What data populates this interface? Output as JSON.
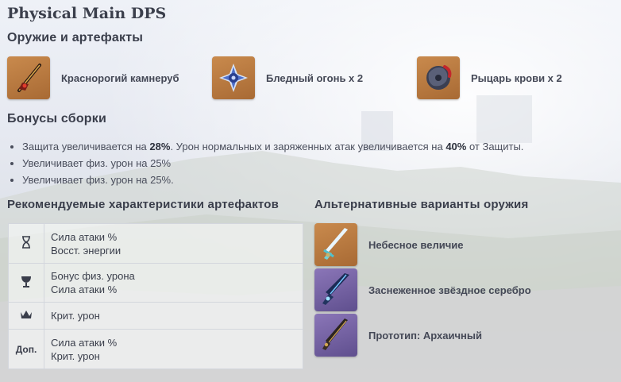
{
  "title": "Physical Main DPS",
  "weapons_section": {
    "heading": "Оружие и артефакты",
    "items": [
      {
        "label": "Краснорогий камнеруб",
        "icon": "axe-weapon-icon"
      },
      {
        "label": "Бледный огонь x 2",
        "icon": "pale-flame-flower-icon"
      },
      {
        "label": "Рыцарь крови x 2",
        "icon": "bloodstained-flower-icon"
      }
    ]
  },
  "set_bonuses": {
    "heading": "Бонусы сборки",
    "items": [
      {
        "pre": "Защита увеличивается на ",
        "b1": "28%",
        "mid": ". Урон нормальных и заряженных атак увеличивается на ",
        "b2": "40%",
        "post": " от Защиты."
      },
      {
        "pre": "Увеличивает физ. урон на 25%",
        "b1": "",
        "mid": "",
        "b2": "",
        "post": ""
      },
      {
        "pre": "Увеличивает физ. урон на 25%.",
        "b1": "",
        "mid": "",
        "b2": "",
        "post": ""
      }
    ]
  },
  "artifact_stats": {
    "heading": "Рекомендуемые характеристики артефактов",
    "rows": [
      {
        "slot_icon": "hourglass-icon",
        "slot_text": "",
        "line1": "Сила атаки %",
        "line2": "Восст. энергии"
      },
      {
        "slot_icon": "goblet-icon",
        "slot_text": "",
        "line1": "Бонус физ. урона",
        "line2": "Сила атаки %"
      },
      {
        "slot_icon": "crown-icon",
        "slot_text": "",
        "line1": "Крит. урон",
        "line2": ""
      },
      {
        "slot_icon": "",
        "slot_text": "Доп.",
        "line1": "Сила атаки %",
        "line2": "Крит. урон"
      }
    ]
  },
  "alt_weapons": {
    "heading": "Альтернативные варианты оружия",
    "items": [
      {
        "label": "Небесное величие",
        "icon": "skyward-pride-icon",
        "rarity": "gold"
      },
      {
        "label": "Заснеженное звёздное серебро",
        "icon": "snow-tombed-starsilver-icon",
        "rarity": "purple"
      },
      {
        "label": "Прототип: Архаичный",
        "icon": "prototype-archaic-icon",
        "rarity": "purple"
      }
    ]
  },
  "colors": {
    "gold_rarity": "#b9773e",
    "purple_rarity": "#6d5a9e"
  }
}
